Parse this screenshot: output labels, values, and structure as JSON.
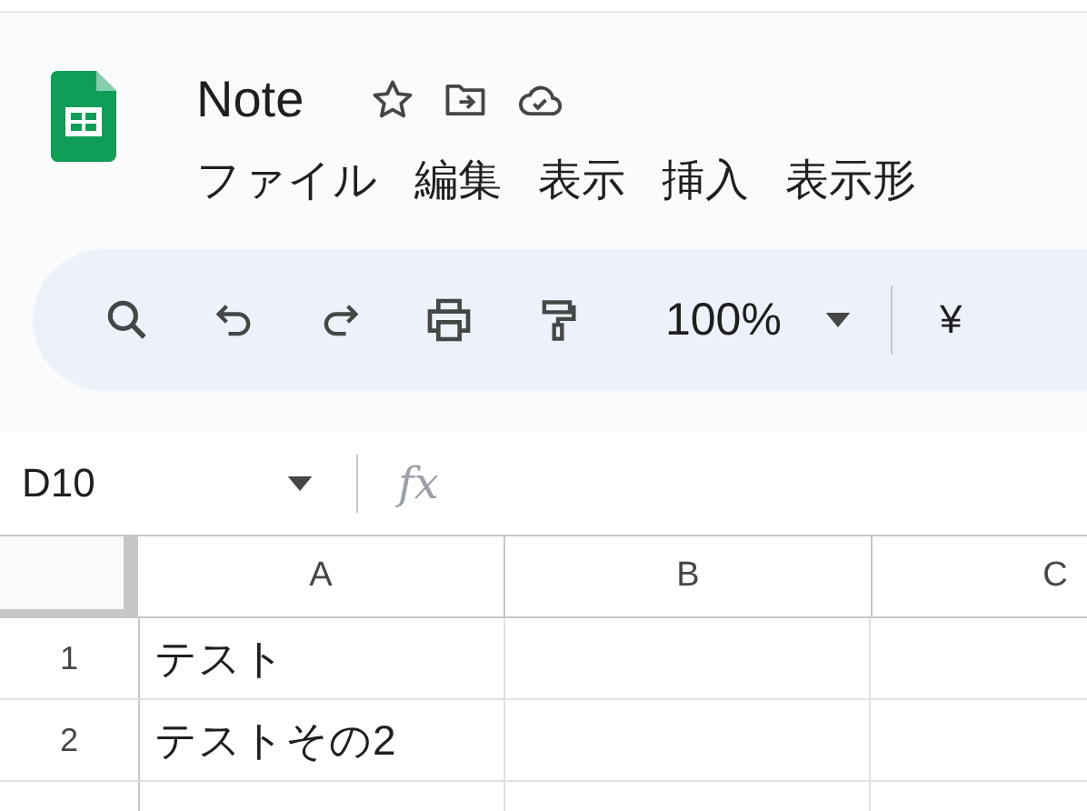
{
  "title": "Note",
  "menu": [
    "ファイル",
    "編集",
    "表示",
    "挿入",
    "表示形"
  ],
  "toolbar": {
    "zoom": "100%",
    "currency": "¥"
  },
  "formula_bar": {
    "name_box": "D10",
    "function_label": "fx"
  },
  "columns": [
    "A",
    "B",
    "C"
  ],
  "rows": [
    {
      "number": "1",
      "cells": [
        "テスト"
      ]
    },
    {
      "number": "2",
      "cells": [
        "テストその2"
      ]
    }
  ]
}
